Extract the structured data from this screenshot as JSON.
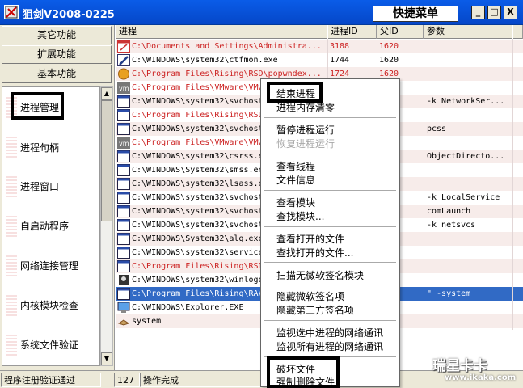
{
  "window": {
    "title": "狙剑V2008-0225",
    "quick_menu": "快捷菜单",
    "min_label": "_",
    "max_label": "□",
    "close_label": "X"
  },
  "left_panel": {
    "buttons": [
      "其它功能",
      "扩展功能",
      "基本功能"
    ],
    "nav_items": [
      "进程管理",
      "进程句柄",
      "进程窗口",
      "自启动程序",
      "网络连接管理",
      "内核模块检查",
      "系统文件验证"
    ]
  },
  "table": {
    "columns": [
      "进程",
      "进程ID",
      "父ID",
      "参数"
    ],
    "rows": [
      {
        "icon": "red-window-icon",
        "path": "C:\\Documents and Settings\\Administra...",
        "pid": "3188",
        "ppid": "1620",
        "args": "",
        "red": true
      },
      {
        "icon": "pen-icon",
        "path": "C:\\WINDOWS\\system32\\ctfmon.exe",
        "pid": "1744",
        "ppid": "1620",
        "args": "",
        "red": false
      },
      {
        "icon": "orb-icon",
        "path": "C:\\Program Files\\Rising\\RSD\\popwndex...",
        "pid": "1724",
        "ppid": "1620",
        "args": "",
        "red": true
      },
      {
        "icon": "vm-icon",
        "path": "C:\\Program Files\\VMware\\VMw",
        "pid": "",
        "ppid": "",
        "args": "",
        "red": true
      },
      {
        "icon": "window-icon",
        "path": "C:\\WINDOWS\\system32\\svchost",
        "pid": "",
        "ppid": "",
        "args": "-k NetworkSer...",
        "red": false
      },
      {
        "icon": "window-icon",
        "path": "C:\\Program Files\\Rising\\RSD",
        "pid": "",
        "ppid": "",
        "args": "",
        "red": true
      },
      {
        "icon": "window-icon",
        "path": "C:\\WINDOWS\\system32\\svchost",
        "pid": "",
        "ppid": "",
        "args": "pcss",
        "red": false
      },
      {
        "icon": "vm-icon",
        "path": "C:\\Program Files\\VMware\\VMw",
        "pid": "",
        "ppid": "",
        "args": "",
        "red": true
      },
      {
        "icon": "window-icon",
        "path": "C:\\WINDOWS\\system32\\csrss.e",
        "pid": "",
        "ppid": "",
        "args": "ObjectDirecto...",
        "red": false
      },
      {
        "icon": "window-icon",
        "path": "C:\\WINDOWS\\System32\\smss.ex",
        "pid": "",
        "ppid": "",
        "args": "",
        "red": false
      },
      {
        "icon": "window-icon",
        "path": "C:\\WINDOWS\\system32\\lsass.e",
        "pid": "",
        "ppid": "",
        "args": "",
        "red": false
      },
      {
        "icon": "window-icon",
        "path": "C:\\WINDOWS\\system32\\svchost",
        "pid": "",
        "ppid": "",
        "args": "-k LocalService",
        "red": false
      },
      {
        "icon": "window-icon",
        "path": "C:\\WINDOWS\\system32\\svchost",
        "pid": "",
        "ppid": "",
        "args": "comLaunch",
        "red": false
      },
      {
        "icon": "window-icon",
        "path": "C:\\WINDOWS\\system32\\svchost",
        "pid": "",
        "ppid": "",
        "args": "-k netsvcs",
        "red": false
      },
      {
        "icon": "window-icon",
        "path": "C:\\WINDOWS\\System32\\alg.exe",
        "pid": "",
        "ppid": "",
        "args": "",
        "red": false
      },
      {
        "icon": "window-icon",
        "path": "C:\\WINDOWS\\system32\\service",
        "pid": "",
        "ppid": "",
        "args": "",
        "red": false
      },
      {
        "icon": "window-icon",
        "path": "C:\\Program Files\\Rising\\RSD",
        "pid": "",
        "ppid": "",
        "args": "",
        "red": true
      },
      {
        "icon": "winlogon-icon",
        "path": "C:\\WINDOWS\\system32\\winlogo",
        "pid": "",
        "ppid": "",
        "args": "",
        "red": false
      },
      {
        "icon": "window-icon",
        "path": "C:\\Program Files\\Rising\\RAV",
        "pid": "",
        "ppid": "",
        "args": "\" -system",
        "red": false,
        "selected": true
      },
      {
        "icon": "monitor-icon",
        "path": "C:\\WINDOWS\\Explorer.EXE",
        "pid": "",
        "ppid": "",
        "args": "",
        "red": false
      },
      {
        "icon": "system-icon",
        "path": "system",
        "pid": "",
        "ppid": "",
        "args": "",
        "red": false
      }
    ]
  },
  "context_menu": {
    "items": [
      {
        "label": "结束进程",
        "disabled": false
      },
      {
        "label": "进程内存清零",
        "disabled": false
      },
      {
        "label": "暂停进程运行",
        "disabled": false
      },
      {
        "label": "恢复进程运行",
        "disabled": true
      },
      {
        "label": "查看线程",
        "disabled": false
      },
      {
        "label": "文件信息",
        "disabled": false
      },
      {
        "label": "查看模块",
        "disabled": false
      },
      {
        "label": "查找模块...",
        "disabled": false
      },
      {
        "label": "查看打开的文件",
        "disabled": false
      },
      {
        "label": "查找打开的文件...",
        "disabled": false
      },
      {
        "label": "扫描无微软签名模块",
        "disabled": false
      },
      {
        "label": "隐藏微软签名项",
        "disabled": false
      },
      {
        "label": "隐藏第三方签名项",
        "disabled": false
      },
      {
        "label": "监视选中进程的网络通讯",
        "disabled": false
      },
      {
        "label": "监视所有进程的网络通讯",
        "disabled": false
      },
      {
        "label": "破坏文件",
        "disabled": false
      },
      {
        "label": "强制删除文件",
        "disabled": false
      }
    ]
  },
  "status": {
    "left": "程序注册验证通过",
    "count": "127",
    "message": "操作完成"
  },
  "watermark": {
    "brand": "瑞星卡卡",
    "url": "www.ikaka.com"
  }
}
